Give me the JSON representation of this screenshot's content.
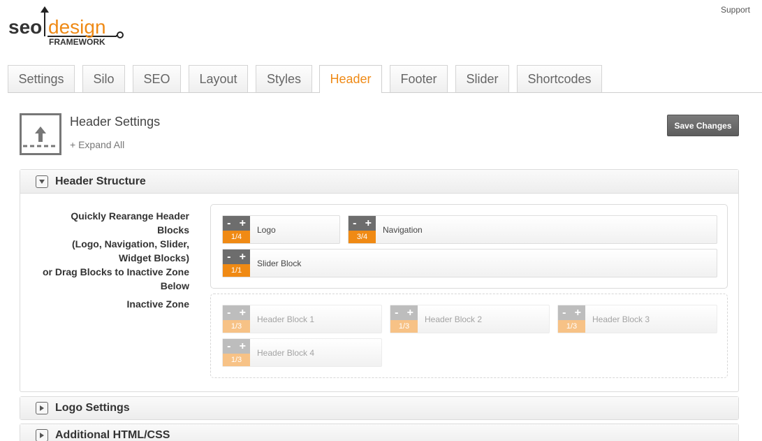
{
  "logo": {
    "word_seo": "seo",
    "word_design": "design",
    "subtitle": "FRAMEWORK"
  },
  "support_link": "Support",
  "tabs": [
    {
      "label": "Settings",
      "active": false
    },
    {
      "label": "Silo",
      "active": false
    },
    {
      "label": "SEO",
      "active": false
    },
    {
      "label": "Layout",
      "active": false
    },
    {
      "label": "Styles",
      "active": false
    },
    {
      "label": "Header",
      "active": true
    },
    {
      "label": "Footer",
      "active": false
    },
    {
      "label": "Slider",
      "active": false
    },
    {
      "label": "Shortcodes",
      "active": false
    }
  ],
  "page": {
    "title": "Header Settings",
    "expand_all": "+ Expand All",
    "save_button": "Save Changes",
    "icon": "header-upload-icon"
  },
  "sections": {
    "header_structure": {
      "title": "Header Structure",
      "expanded": true
    },
    "logo_settings": {
      "title": "Logo Settings",
      "expanded": false
    },
    "additional_html": {
      "title": "Additional HTML/CSS",
      "expanded": false
    }
  },
  "structure": {
    "rearrange_label_lines": [
      "Quickly Rearange Header",
      "Blocks",
      "(Logo, Navigation, Slider,",
      "Widget Blocks)",
      "or Drag Blocks to Inactive Zone",
      "Below"
    ],
    "inactive_label": "Inactive Zone",
    "minus": "-",
    "plus": "+",
    "active_blocks": [
      {
        "label": "Logo",
        "size": "1/4"
      },
      {
        "label": "Navigation",
        "size": "3/4"
      },
      {
        "label": "Slider Block",
        "size": "1/1"
      }
    ],
    "inactive_blocks": [
      {
        "label": "Header Block 1",
        "size": "1/3"
      },
      {
        "label": "Header Block 2",
        "size": "1/3"
      },
      {
        "label": "Header Block 3",
        "size": "1/3"
      },
      {
        "label": "Header Block 4",
        "size": "1/3"
      }
    ]
  },
  "colors": {
    "accent": "#f08a14",
    "active_tab": "#ef8a16",
    "control_dark": "#6d6d6d"
  }
}
